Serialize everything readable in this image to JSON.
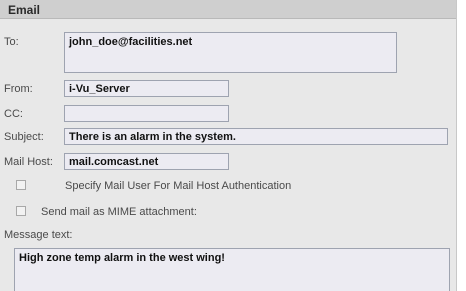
{
  "section": {
    "title": "Email"
  },
  "to": {
    "label": "To:",
    "value": "john_doe@facilities.net"
  },
  "from": {
    "label": "From:",
    "value": "i-Vu_Server"
  },
  "cc": {
    "label": "CC:",
    "value": ""
  },
  "subject": {
    "label": "Subject:",
    "value": "There is an alarm in the system."
  },
  "mail_host": {
    "label": "Mail Host:",
    "value": "mail.comcast.net"
  },
  "auth_option": {
    "label": "Specify Mail User For Mail Host Authentication",
    "checked": false
  },
  "mime_option": {
    "label": "Send mail as MIME attachment:",
    "checked": false
  },
  "message": {
    "label": "Message text:",
    "value": "High zone temp alarm in the west wing!"
  },
  "colors": {
    "panel_bg": "#e8e8e8",
    "header_bg": "#cfcfcf",
    "field_bg": "#ecebf2",
    "field_border": "#9ea3b0"
  }
}
